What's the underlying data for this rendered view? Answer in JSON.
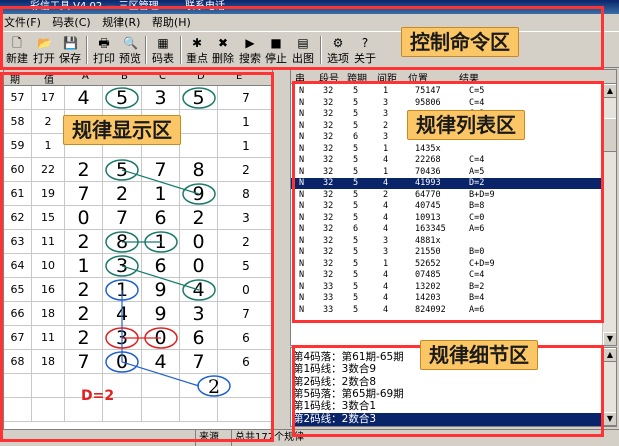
{
  "window": {
    "title": "…彩信工具 V4.02 — 三区管理 …… 联系电话 …"
  },
  "menu": [
    {
      "label": "文件(F)"
    },
    {
      "label": "码表(C)"
    },
    {
      "label": "规律(R)"
    },
    {
      "label": "帮助(H)"
    }
  ],
  "toolbar": [
    {
      "label": "新建",
      "icon": "new-file-icon",
      "glyph": "🗋"
    },
    {
      "label": "打开",
      "icon": "open-folder-icon",
      "glyph": "📂"
    },
    {
      "label": "保存",
      "icon": "save-disk-icon",
      "glyph": "💾"
    },
    {
      "label": "打印",
      "icon": "printer-icon",
      "glyph": "🖶"
    },
    {
      "label": "预览",
      "icon": "preview-icon",
      "glyph": "🔍"
    },
    {
      "label": "码表",
      "icon": "code-table-icon",
      "glyph": "▦"
    },
    {
      "label": "重点",
      "icon": "highlight-star-icon",
      "glyph": "✱"
    },
    {
      "label": "删除",
      "icon": "delete-icon",
      "glyph": "✖"
    },
    {
      "label": "搜索",
      "icon": "search-play-icon",
      "glyph": "▶"
    },
    {
      "label": "停止",
      "icon": "stop-icon",
      "glyph": "■"
    },
    {
      "label": "出图",
      "icon": "export-chart-icon",
      "glyph": "▤"
    },
    {
      "label": "选项",
      "icon": "options-icon",
      "glyph": "⚙"
    },
    {
      "label": "关于",
      "icon": "about-icon",
      "glyph": "?"
    }
  ],
  "annotations": {
    "control": "控制命令区",
    "display": "规律显示区",
    "list": "规律列表区",
    "detail": "规律细节区"
  },
  "grid": {
    "headers": [
      "期",
      "值",
      "A",
      "B",
      "C",
      "D",
      "E"
    ],
    "rows": [
      [
        "57",
        "17",
        "4",
        "5",
        "3",
        "5",
        "7"
      ],
      [
        "58",
        "2",
        "",
        "",
        "",
        "",
        "1"
      ],
      [
        "59",
        "1",
        "",
        "",
        "",
        "",
        "1"
      ],
      [
        "60",
        "22",
        "2",
        "5",
        "7",
        "8",
        "2"
      ],
      [
        "61",
        "19",
        "7",
        "2",
        "1",
        "9",
        "8"
      ],
      [
        "62",
        "15",
        "0",
        "7",
        "6",
        "2",
        "3"
      ],
      [
        "63",
        "11",
        "2",
        "8",
        "1",
        "0",
        "2"
      ],
      [
        "64",
        "10",
        "1",
        "3",
        "6",
        "0",
        "5"
      ],
      [
        "65",
        "16",
        "2",
        "1",
        "9",
        "4",
        "0"
      ],
      [
        "66",
        "18",
        "2",
        "4",
        "9",
        "3",
        "7"
      ],
      [
        "67",
        "11",
        "2",
        "3",
        "0",
        "6",
        "6"
      ],
      [
        "68",
        "18",
        "7",
        "0",
        "4",
        "7",
        "6"
      ]
    ],
    "extra_value": "2",
    "d_label": "D=2"
  },
  "list": {
    "headers": [
      "串",
      "段号",
      "跨期",
      "间距",
      "位置",
      "结果"
    ],
    "rows": [
      [
        "N",
        "32",
        "5",
        "1",
        "75147",
        "C=5"
      ],
      [
        "N",
        "32",
        "5",
        "3",
        "95806",
        "C=4"
      ],
      [
        "N",
        "32",
        "5",
        "3",
        "",
        "C=2"
      ],
      [
        "N",
        "32",
        "5",
        "2",
        "",
        "C=7"
      ],
      [
        "N",
        "32",
        "6",
        "3",
        "697506",
        "A=3"
      ],
      [
        "N",
        "32",
        "5",
        "1",
        "1435x",
        ""
      ],
      [
        "N",
        "32",
        "5",
        "4",
        "22268",
        "C=4"
      ],
      [
        "N",
        "32",
        "5",
        "1",
        "70436",
        "A=5"
      ],
      [
        "N",
        "32",
        "5",
        "4",
        "41993",
        "D=2"
      ],
      [
        "N",
        "32",
        "5",
        "2",
        "64770",
        "B+D=9"
      ],
      [
        "N",
        "32",
        "5",
        "4",
        "40745",
        "B=8"
      ],
      [
        "N",
        "32",
        "5",
        "4",
        "10913",
        "C=0"
      ],
      [
        "N",
        "32",
        "6",
        "4",
        "163345",
        "A=6"
      ],
      [
        "N",
        "32",
        "5",
        "3",
        "4881x",
        ""
      ],
      [
        "N",
        "32",
        "5",
        "3",
        "21550",
        "B=0"
      ],
      [
        "N",
        "32",
        "5",
        "1",
        "52652",
        "C+D=9"
      ],
      [
        "N",
        "32",
        "5",
        "4",
        "07485",
        "C=4"
      ],
      [
        "N",
        "33",
        "5",
        "4",
        "13202",
        "B=2"
      ],
      [
        "N",
        "33",
        "5",
        "4",
        "14203",
        "B=4"
      ],
      [
        "N",
        "33",
        "5",
        "4",
        "824092",
        "A=6"
      ]
    ],
    "selected_index": 8
  },
  "detail": {
    "rows": [
      "第4码落：第61期-65期",
      "第1码线：3数合9",
      "第2码线：2数合8",
      "第5码落：第65期-69期",
      "第1码线：3数合1",
      "第2码线：2数合3"
    ],
    "selected_index": 5
  },
  "status": {
    "left": "",
    "mid": "来源数",
    "right": "总共177个规律"
  }
}
